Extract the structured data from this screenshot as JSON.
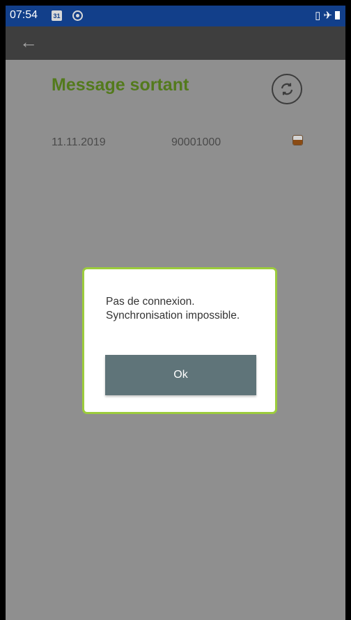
{
  "status_bar": {
    "time": "07:54",
    "calendar_day": "31",
    "icons": [
      "calendar-icon",
      "chrome-icon",
      "vibrate-icon",
      "airplane-icon",
      "battery-icon"
    ]
  },
  "app_bar": {
    "back_icon": "arrow-left-icon",
    "back_glyph": "←"
  },
  "page": {
    "title": "Message sortant",
    "title_color": "#537a1c",
    "sync_icon": "sync-icon"
  },
  "messages": [
    {
      "date": "11.11.2019",
      "number": "90001000",
      "status_icon": "pending-status-icon"
    }
  ],
  "dialog": {
    "message_line1": "Pas de connexion.",
    "message_line2": "Synchronisation impossible.",
    "ok_label": "Ok",
    "border_color": "#9ccc3c",
    "button_color": "#5f7479"
  }
}
